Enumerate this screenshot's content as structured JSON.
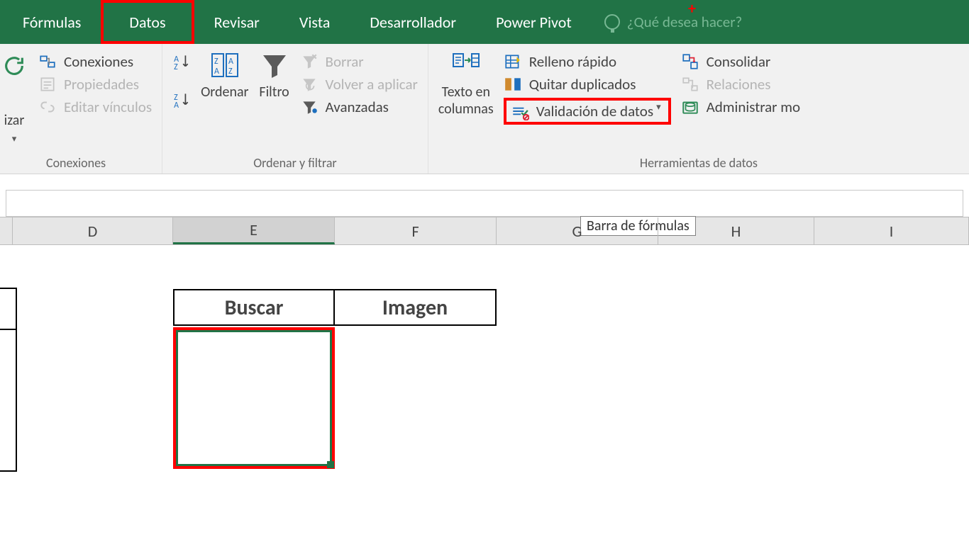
{
  "tabs": {
    "formulas": "Fórmulas",
    "datos": "Datos",
    "revisar": "Revisar",
    "vista": "Vista",
    "desarrollador": "Desarrollador",
    "powerpivot": "Power Pivot"
  },
  "tell_me": {
    "placeholder": "¿Qué desea hacer?"
  },
  "ribbon": {
    "refresh": {
      "line1": "izar"
    },
    "conexiones_grp": {
      "conexiones": "Conexiones",
      "propiedades": "Propiedades",
      "editar_vinculos": "Editar vínculos",
      "label": "Conexiones"
    },
    "orden_grp": {
      "ordenar": "Ordenar",
      "filtro": "Filtro",
      "borrar": "Borrar",
      "volver_aplicar": "Volver a aplicar",
      "avanzadas": "Avanzadas",
      "label": "Ordenar y filtrar"
    },
    "texto_cols": {
      "line1": "Texto en",
      "line2": "columnas"
    },
    "tools_grp": {
      "relleno": "Relleno rápido",
      "quitar_dup": "Quitar duplicados",
      "validacion": "Validación de datos",
      "consolidar": "Consolidar",
      "relaciones": "Relaciones",
      "admin_modelo": "Administrar mo",
      "label": "Herramientas de datos"
    }
  },
  "formula_bar": {
    "tooltip": "Barra de fórmulas"
  },
  "columns": {
    "D": "D",
    "E": "E",
    "F": "F",
    "G": "G",
    "H": "H",
    "I": "I"
  },
  "table": {
    "buscar": "Buscar",
    "imagen": "Imagen"
  }
}
